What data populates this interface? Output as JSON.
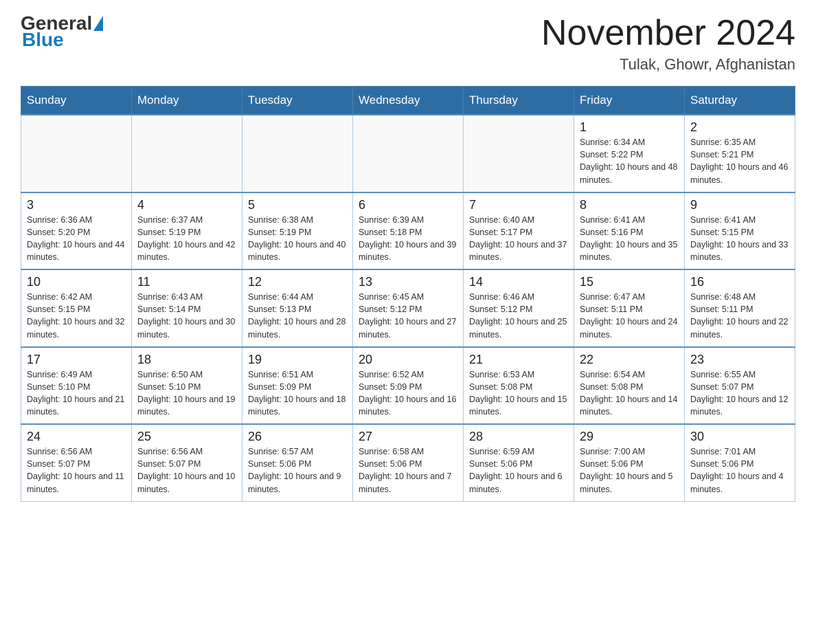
{
  "header": {
    "logo_general": "General",
    "logo_blue": "Blue",
    "month_title": "November 2024",
    "location": "Tulak, Ghowr, Afghanistan"
  },
  "days_of_week": [
    "Sunday",
    "Monday",
    "Tuesday",
    "Wednesday",
    "Thursday",
    "Friday",
    "Saturday"
  ],
  "weeks": [
    [
      {
        "num": "",
        "info": ""
      },
      {
        "num": "",
        "info": ""
      },
      {
        "num": "",
        "info": ""
      },
      {
        "num": "",
        "info": ""
      },
      {
        "num": "",
        "info": ""
      },
      {
        "num": "1",
        "info": "Sunrise: 6:34 AM\nSunset: 5:22 PM\nDaylight: 10 hours and 48 minutes."
      },
      {
        "num": "2",
        "info": "Sunrise: 6:35 AM\nSunset: 5:21 PM\nDaylight: 10 hours and 46 minutes."
      }
    ],
    [
      {
        "num": "3",
        "info": "Sunrise: 6:36 AM\nSunset: 5:20 PM\nDaylight: 10 hours and 44 minutes."
      },
      {
        "num": "4",
        "info": "Sunrise: 6:37 AM\nSunset: 5:19 PM\nDaylight: 10 hours and 42 minutes."
      },
      {
        "num": "5",
        "info": "Sunrise: 6:38 AM\nSunset: 5:19 PM\nDaylight: 10 hours and 40 minutes."
      },
      {
        "num": "6",
        "info": "Sunrise: 6:39 AM\nSunset: 5:18 PM\nDaylight: 10 hours and 39 minutes."
      },
      {
        "num": "7",
        "info": "Sunrise: 6:40 AM\nSunset: 5:17 PM\nDaylight: 10 hours and 37 minutes."
      },
      {
        "num": "8",
        "info": "Sunrise: 6:41 AM\nSunset: 5:16 PM\nDaylight: 10 hours and 35 minutes."
      },
      {
        "num": "9",
        "info": "Sunrise: 6:41 AM\nSunset: 5:15 PM\nDaylight: 10 hours and 33 minutes."
      }
    ],
    [
      {
        "num": "10",
        "info": "Sunrise: 6:42 AM\nSunset: 5:15 PM\nDaylight: 10 hours and 32 minutes."
      },
      {
        "num": "11",
        "info": "Sunrise: 6:43 AM\nSunset: 5:14 PM\nDaylight: 10 hours and 30 minutes."
      },
      {
        "num": "12",
        "info": "Sunrise: 6:44 AM\nSunset: 5:13 PM\nDaylight: 10 hours and 28 minutes."
      },
      {
        "num": "13",
        "info": "Sunrise: 6:45 AM\nSunset: 5:12 PM\nDaylight: 10 hours and 27 minutes."
      },
      {
        "num": "14",
        "info": "Sunrise: 6:46 AM\nSunset: 5:12 PM\nDaylight: 10 hours and 25 minutes."
      },
      {
        "num": "15",
        "info": "Sunrise: 6:47 AM\nSunset: 5:11 PM\nDaylight: 10 hours and 24 minutes."
      },
      {
        "num": "16",
        "info": "Sunrise: 6:48 AM\nSunset: 5:11 PM\nDaylight: 10 hours and 22 minutes."
      }
    ],
    [
      {
        "num": "17",
        "info": "Sunrise: 6:49 AM\nSunset: 5:10 PM\nDaylight: 10 hours and 21 minutes."
      },
      {
        "num": "18",
        "info": "Sunrise: 6:50 AM\nSunset: 5:10 PM\nDaylight: 10 hours and 19 minutes."
      },
      {
        "num": "19",
        "info": "Sunrise: 6:51 AM\nSunset: 5:09 PM\nDaylight: 10 hours and 18 minutes."
      },
      {
        "num": "20",
        "info": "Sunrise: 6:52 AM\nSunset: 5:09 PM\nDaylight: 10 hours and 16 minutes."
      },
      {
        "num": "21",
        "info": "Sunrise: 6:53 AM\nSunset: 5:08 PM\nDaylight: 10 hours and 15 minutes."
      },
      {
        "num": "22",
        "info": "Sunrise: 6:54 AM\nSunset: 5:08 PM\nDaylight: 10 hours and 14 minutes."
      },
      {
        "num": "23",
        "info": "Sunrise: 6:55 AM\nSunset: 5:07 PM\nDaylight: 10 hours and 12 minutes."
      }
    ],
    [
      {
        "num": "24",
        "info": "Sunrise: 6:56 AM\nSunset: 5:07 PM\nDaylight: 10 hours and 11 minutes."
      },
      {
        "num": "25",
        "info": "Sunrise: 6:56 AM\nSunset: 5:07 PM\nDaylight: 10 hours and 10 minutes."
      },
      {
        "num": "26",
        "info": "Sunrise: 6:57 AM\nSunset: 5:06 PM\nDaylight: 10 hours and 9 minutes."
      },
      {
        "num": "27",
        "info": "Sunrise: 6:58 AM\nSunset: 5:06 PM\nDaylight: 10 hours and 7 minutes."
      },
      {
        "num": "28",
        "info": "Sunrise: 6:59 AM\nSunset: 5:06 PM\nDaylight: 10 hours and 6 minutes."
      },
      {
        "num": "29",
        "info": "Sunrise: 7:00 AM\nSunset: 5:06 PM\nDaylight: 10 hours and 5 minutes."
      },
      {
        "num": "30",
        "info": "Sunrise: 7:01 AM\nSunset: 5:06 PM\nDaylight: 10 hours and 4 minutes."
      }
    ]
  ]
}
